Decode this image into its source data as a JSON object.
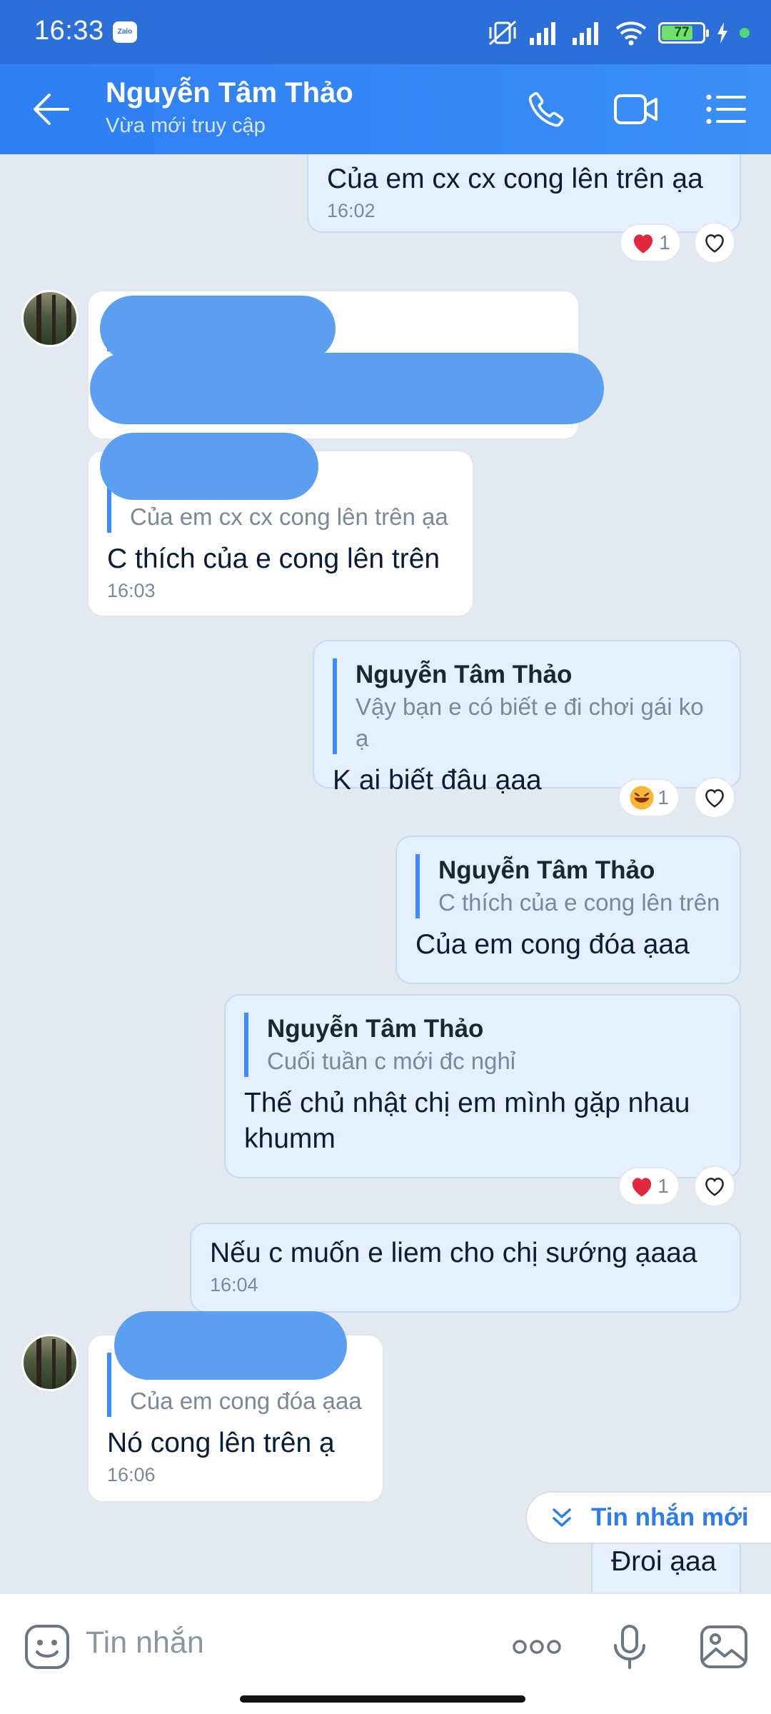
{
  "status_bar": {
    "time": "16:33",
    "app_badge": "Zalo",
    "battery": "77",
    "battery_level": 0.77
  },
  "header": {
    "contact_name": "Nguyễn Tâm Thảo",
    "contact_status": "Vừa mới truy cập"
  },
  "messages": [
    {
      "side": "me",
      "text": "Của em cx cx cong lên trên ạa",
      "time": "16:02",
      "reaction": "heart",
      "reaction_count": "1"
    },
    {
      "side": "them",
      "redacted": true
    },
    {
      "side": "them",
      "quote_text": "Của em cx cx cong lên trên ạa",
      "text": "C thích của e cong lên trên",
      "time": "16:03"
    },
    {
      "side": "me",
      "quote_name": "Nguyễn Tâm Thảo",
      "quote_text": "Vậy bạn e có biết e đi chơi gái ko ạ",
      "text": "K ai biết đâu ạaa",
      "reaction": "laugh",
      "reaction_count": "1"
    },
    {
      "side": "me",
      "quote_name": "Nguyễn Tâm Thảo",
      "quote_text": "C thích của e cong lên trên",
      "text": "Của em cong đóa ạaa"
    },
    {
      "side": "me",
      "quote_name": "Nguyễn Tâm Thảo",
      "quote_text": "Cuối tuần c mới đc nghỉ",
      "text_line1": "Thế chủ nhật chị em mình gặp nhau",
      "text_line2": "khumm",
      "reaction": "heart",
      "reaction_count": "1"
    },
    {
      "side": "me",
      "text": "Nếu c muốn e liem cho chị sướng ạaaa",
      "time": "16:04"
    },
    {
      "side": "them",
      "quote_text": "Của em cong đóa ạaa",
      "text": "Nó cong lên trên ạ",
      "time": "16:06"
    },
    {
      "side": "me",
      "text": "Đroi ạaa"
    }
  ],
  "new_messages_button": "Tin nhắn mới",
  "input": {
    "placeholder": "Tin nhắn"
  },
  "colors": {
    "header": "#2e7ff3",
    "my_bubble": "#e5efff",
    "their_bubble": "#ffffff",
    "chat_background": "#e2e9f1",
    "accent": "#3e8ef7"
  }
}
